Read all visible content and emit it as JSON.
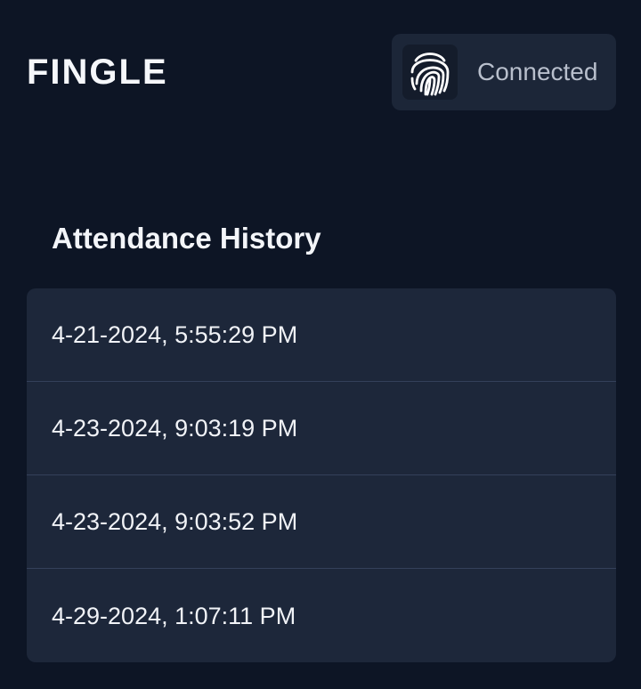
{
  "header": {
    "app_title": "FINGLE",
    "status": {
      "icon": "fingerprint-icon",
      "label": "Connected"
    }
  },
  "attendance": {
    "title": "Attendance History",
    "entries": [
      "4-21-2024, 5:55:29 PM",
      "4-23-2024, 9:03:19 PM",
      "4-23-2024, 9:03:52 PM",
      "4-29-2024, 1:07:11 PM"
    ]
  },
  "colors": {
    "background": "#0d1525",
    "card": "#1d273a",
    "status_pill": "#1c2638",
    "text": "#f3f5f9",
    "muted_text": "#b8bfcc"
  }
}
